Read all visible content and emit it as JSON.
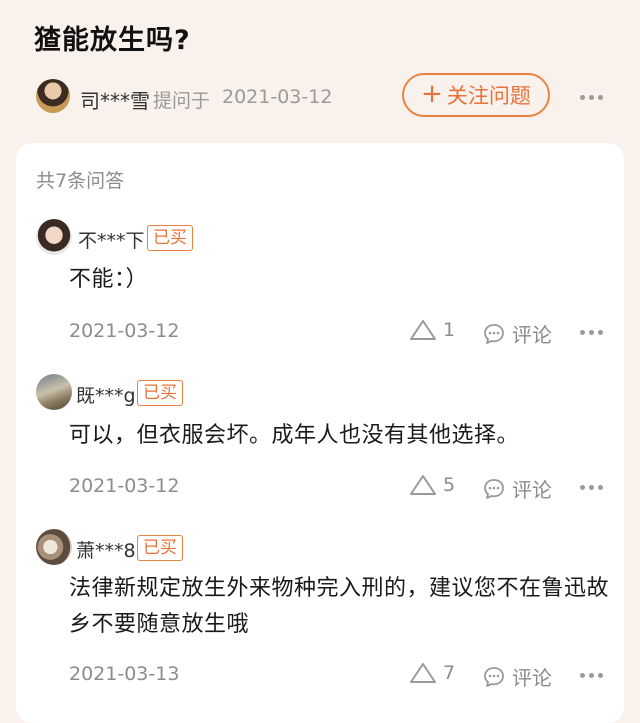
{
  "question": {
    "title": "猹能放生吗?",
    "asker": "司***雪",
    "asked_label": "提问于",
    "asked_date": "2021-03-12",
    "follow_label": "关注问题"
  },
  "answers_count": "共7条问答",
  "answers": [
    {
      "user": "不***下",
      "badge": "已买",
      "text": "不能：）",
      "date": "2021-03-12",
      "likes": "1",
      "comment_label": "评论"
    },
    {
      "user": "既***g",
      "badge": "已买",
      "text": "可以，但衣服会坏。成年人也没有其他选择。",
      "date": "2021-03-12",
      "likes": "5",
      "comment_label": "评论"
    },
    {
      "user": "萧***8",
      "badge": "已买",
      "text": "法律新规定放生外来物种完入刑的，建议您不在鲁迅故乡不要随意放生哦",
      "date": "2021-03-13",
      "likes": "7",
      "comment_label": "评论"
    }
  ],
  "colors": {
    "accent": "#e8733a",
    "background": "#f8f1ec",
    "card": "#ffffff",
    "muted": "#8c8c8c"
  }
}
